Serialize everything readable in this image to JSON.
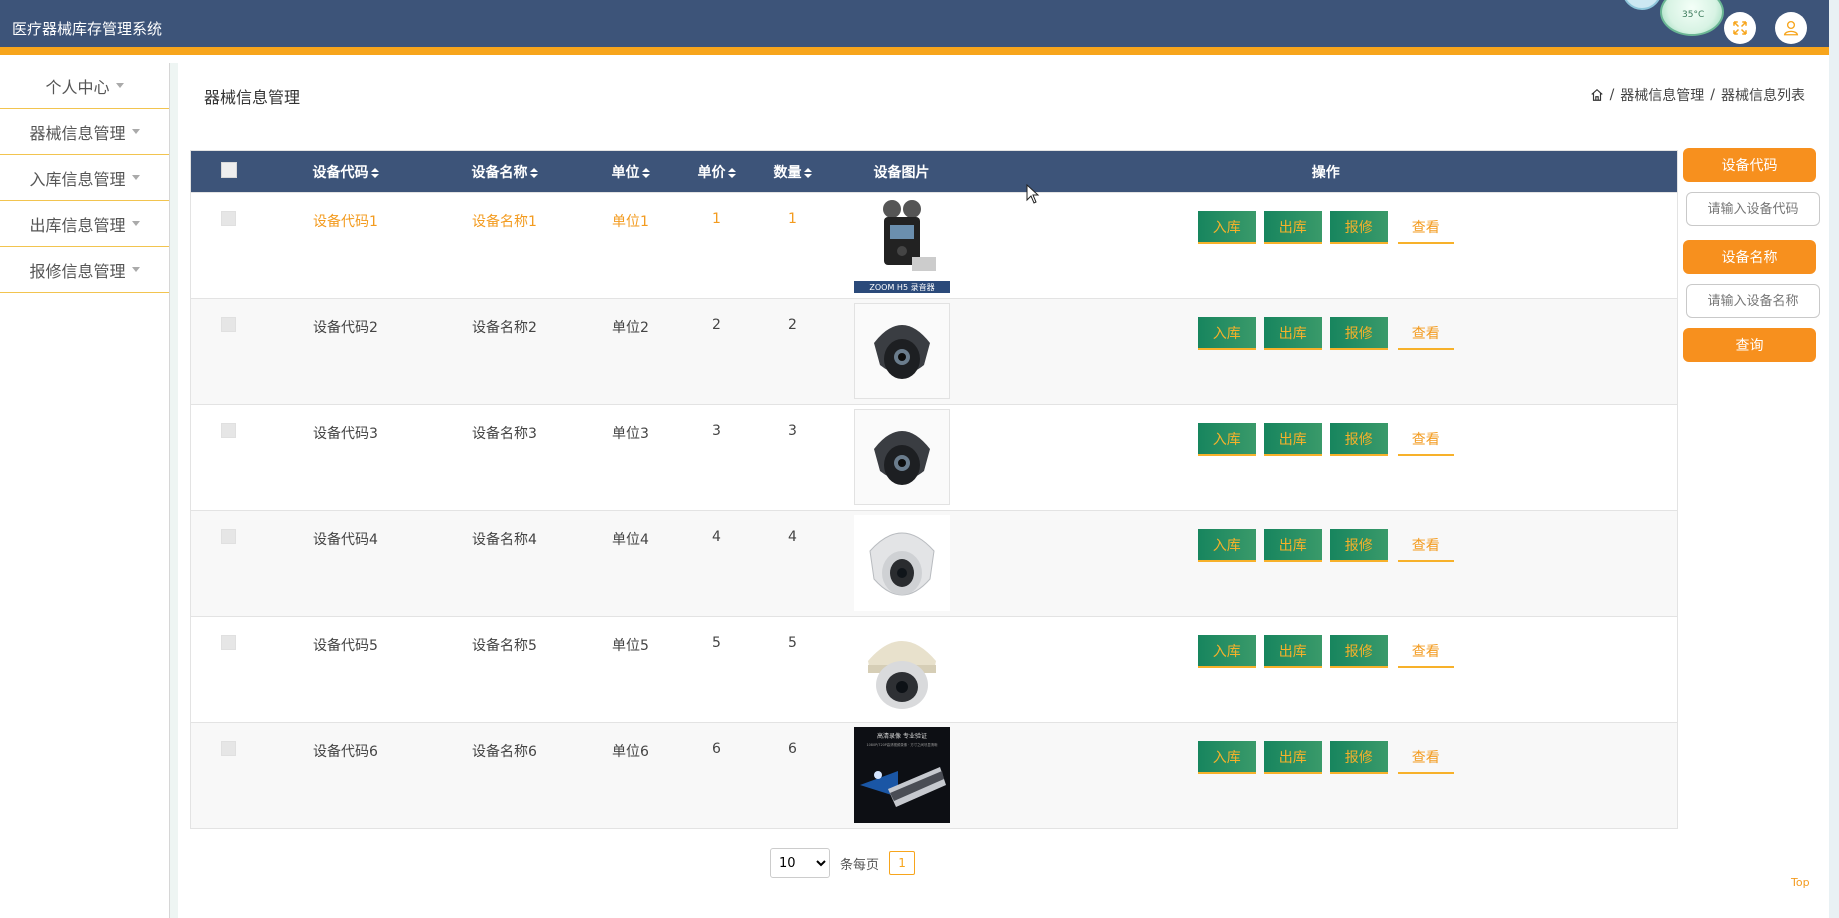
{
  "header": {
    "app_title": "医疗器械库存管理系统",
    "weather_temp": "35°C"
  },
  "sidebar": {
    "items": [
      {
        "label": "个人中心"
      },
      {
        "label": "器械信息管理"
      },
      {
        "label": "入库信息管理"
      },
      {
        "label": "出库信息管理"
      },
      {
        "label": "报修信息管理"
      }
    ]
  },
  "page": {
    "title": "器械信息管理"
  },
  "breadcrumb": {
    "items": [
      "器械信息管理",
      "器械信息列表"
    ],
    "sep": "/"
  },
  "table": {
    "headers": [
      "设备代码",
      "设备名称",
      "单位",
      "单价",
      "数量",
      "设备图片",
      "操作"
    ],
    "rows": [
      {
        "code": "设备代码1",
        "name": "设备名称1",
        "unit": "单位1",
        "price": "1",
        "qty": "1",
        "image": "recorder-image"
      },
      {
        "code": "设备代码2",
        "name": "设备名称2",
        "unit": "单位2",
        "price": "2",
        "qty": "2",
        "image": "dome-camera-dark-image"
      },
      {
        "code": "设备代码3",
        "name": "设备名称3",
        "unit": "单位3",
        "price": "3",
        "qty": "3",
        "image": "dome-camera-dark-image"
      },
      {
        "code": "设备代码4",
        "name": "设备名称4",
        "unit": "单位4",
        "price": "4",
        "qty": "4",
        "image": "dome-camera-white-image"
      },
      {
        "code": "设备代码5",
        "name": "设备名称5",
        "unit": "单位5",
        "price": "5",
        "qty": "5",
        "image": "dome-camera-beige-image"
      },
      {
        "code": "设备代码6",
        "name": "设备名称6",
        "unit": "单位6",
        "price": "6",
        "qty": "6",
        "image": "projector-ad-image"
      }
    ],
    "actions": {
      "stock_in": "入库",
      "stock_out": "出库",
      "repair": "报修",
      "view": "查看"
    },
    "image_labels": {
      "recorder": "ZOOM H5 录音器",
      "ad_line1": "高清录像 专业验证",
      "ad_line2": "1080P/720P高清视频录像 · 方寸之间尽显清晰"
    }
  },
  "filters": {
    "code_label": "设备代码",
    "code_placeholder": "请输入设备代码",
    "name_label": "设备名称",
    "name_placeholder": "请输入设备名称",
    "query_button": "查询"
  },
  "pagination": {
    "page_size": "10",
    "per_page_label": "条每页",
    "current_page": "1"
  },
  "top_link": "Top",
  "colors": {
    "header": "#3d5479",
    "accent": "#f7a51c",
    "button_green": "#17855e",
    "orange": "#f39b1f"
  }
}
